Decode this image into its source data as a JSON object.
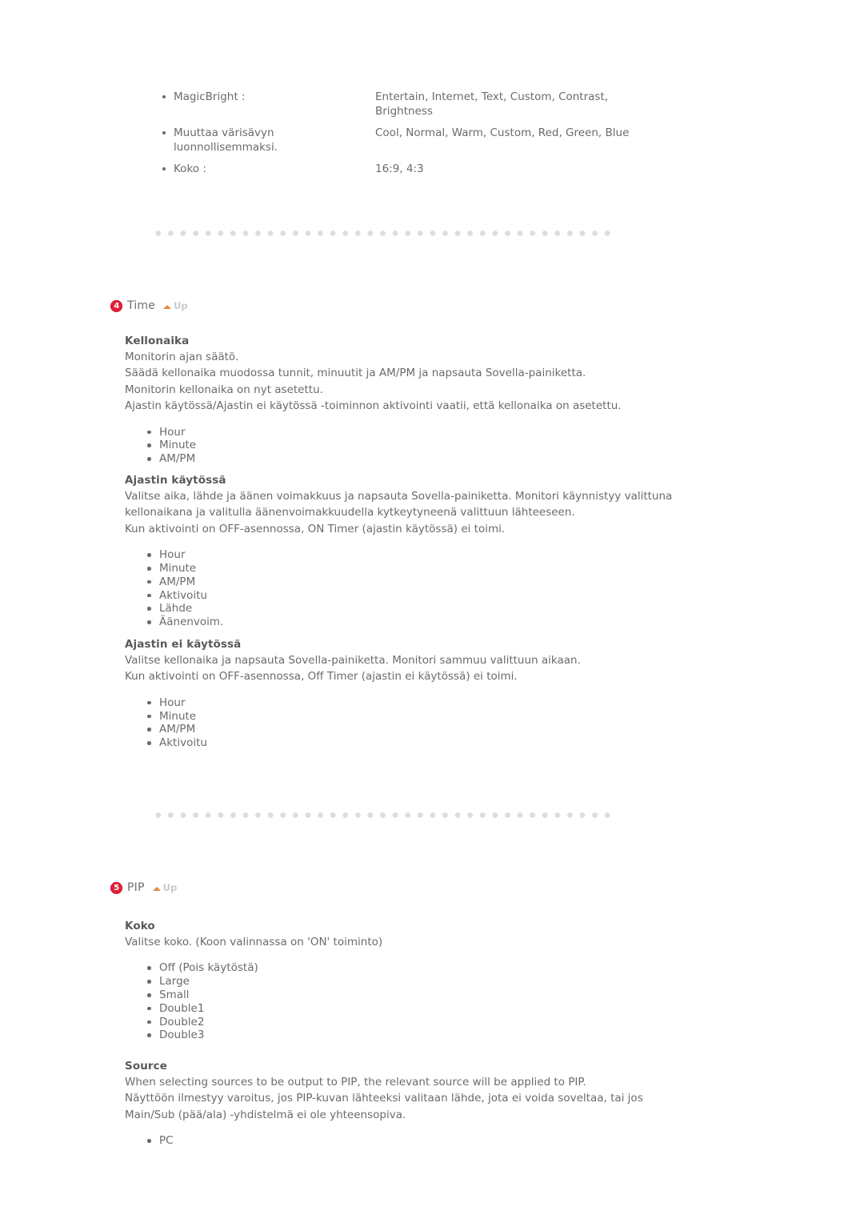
{
  "spec_table": {
    "rows": [
      {
        "label": "MagicBright :",
        "value": "Entertain, Internet, Text, Custom, Contrast, Brightness"
      },
      {
        "label": "Muuttaa värisävyn luonnollisemmaksi.",
        "value": "Cool, Normal, Warm, Custom, Red, Green, Blue"
      },
      {
        "label": "Koko :",
        "value": "16:9, 4:3"
      }
    ]
  },
  "sections": [
    {
      "number": "4",
      "title": "Time",
      "up_label": "Up",
      "badge_color": "#e0203a",
      "arrow_color": "#e8883c"
    },
    {
      "number": "5",
      "title": "PIP",
      "up_label": "Up",
      "badge_color": "#e0203a",
      "arrow_color": "#e8883c"
    }
  ],
  "blocks": {
    "kellonaika": {
      "title": "Kellonaika",
      "lines": [
        "Monitorin ajan säätö.",
        "Säädä kellonaika muodossa tunnit, minuutit ja AM/PM ja napsauta Sovella-painiketta.",
        "Monitorin kellonaika on nyt asetettu.",
        "Ajastin käytössä/Ajastin ei käytössä -toiminnon aktivointi vaatii, että kellonaika on asetettu."
      ],
      "options": [
        "Hour",
        "Minute",
        "AM/PM"
      ]
    },
    "ajastin_kaytossa": {
      "title": "Ajastin käytössä",
      "lines": [
        "Valitse aika, lähde ja äänen voimakkuus ja napsauta Sovella-painiketta. Monitori käynnistyy valittuna kellonaikana ja valitulla äänenvoimakkuudella kytkeytyneenä valittuun lähteeseen.",
        "Kun aktivointi on OFF-asennossa, ON Timer (ajastin käytössä) ei toimi."
      ],
      "options": [
        "Hour",
        "Minute",
        "AM/PM",
        "Aktivoitu",
        "Lähde",
        "Äänenvoim."
      ]
    },
    "ajastin_ei_kaytossa": {
      "title": "Ajastin ei käytössä",
      "lines": [
        "Valitse kellonaika ja napsauta Sovella-painiketta. Monitori sammuu valittuun aikaan.",
        "Kun aktivointi on OFF-asennossa, Off Timer (ajastin ei käytössä) ei toimi."
      ],
      "options": [
        "Hour",
        "Minute",
        "AM/PM",
        "Aktivoitu"
      ]
    },
    "pip_koko": {
      "title": "Koko",
      "lines": [
        "Valitse koko. (Koon valinnassa on 'ON' toiminto)"
      ],
      "options": [
        "Off (Pois käytöstä)",
        "Large",
        "Small",
        "Double1",
        "Double2",
        "Double3"
      ]
    },
    "pip_source": {
      "title": "Source",
      "lines": [
        "When selecting sources to be output to PIP, the relevant source will be applied to PIP.",
        "Näyttöön ilmestyy varoitus, jos PIP-kuvan lähteeksi valitaan lähde, jota ei voida soveltaa, tai jos Main/Sub (pää/ala) -yhdistelmä ei ole yhteensopiva."
      ],
      "options": [
        "PC"
      ]
    }
  }
}
